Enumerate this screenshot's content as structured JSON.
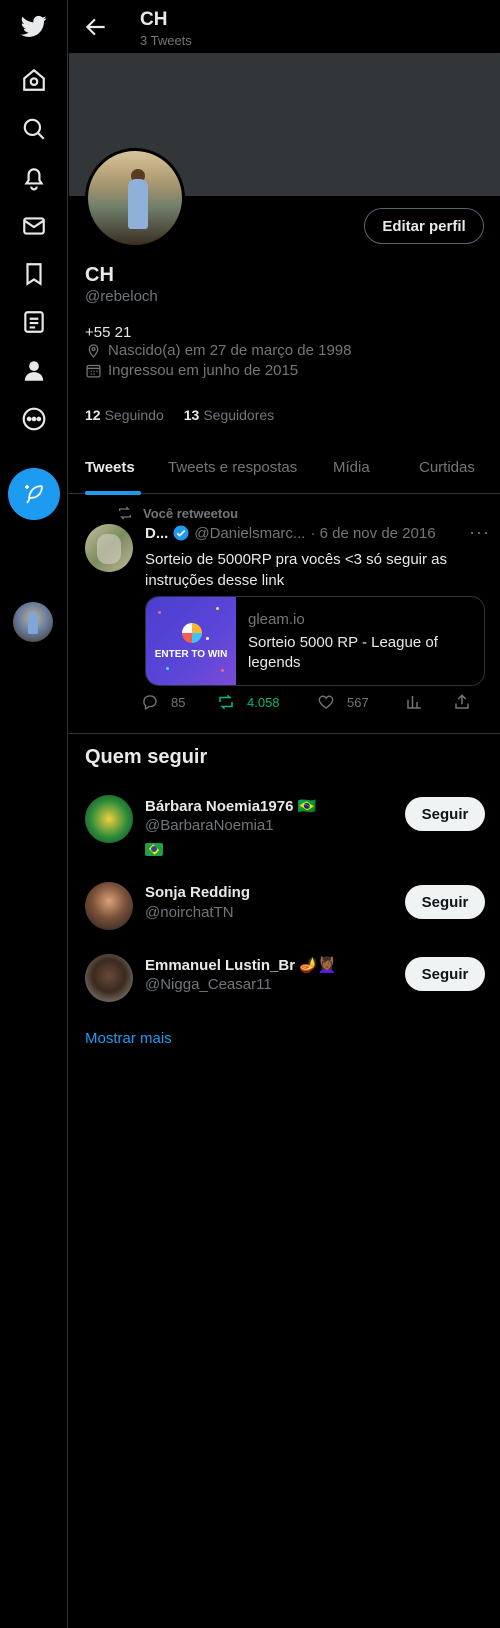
{
  "sidebar": {
    "items": [
      {
        "icon": "twitter-logo-icon"
      },
      {
        "icon": "home-icon"
      },
      {
        "icon": "search-icon"
      },
      {
        "icon": "bell-icon"
      },
      {
        "icon": "mail-icon"
      },
      {
        "icon": "bookmark-icon"
      },
      {
        "icon": "list-icon"
      },
      {
        "icon": "profile-icon"
      },
      {
        "icon": "more-icon"
      }
    ],
    "compose_icon": "compose-feather-icon"
  },
  "header": {
    "title": "CH",
    "subtitle": "3 Tweets"
  },
  "profile": {
    "edit_label": "Editar perfil",
    "name": "CH",
    "handle": "@rebeloch",
    "bio": "+55 21",
    "birth": "Nascido(a) em 27 de março de 1998",
    "joined": "Ingressou em junho de 2015",
    "following_count": "12",
    "following_label": "Seguindo",
    "followers_count": "13",
    "followers_label": "Seguidores"
  },
  "tabs": [
    {
      "label": "Tweets"
    },
    {
      "label": "Tweets e respostas"
    },
    {
      "label": "Mídia"
    },
    {
      "label": "Curtidas"
    }
  ],
  "tweet": {
    "retweet_label": "Você retweetou",
    "name": "D...",
    "handle": "@Danielsmarc...",
    "date": "· 6 de nov de 2016",
    "text": "Sorteio de 5000RP pra vocês <3 só seguir as instruções desse link",
    "card": {
      "image_text": "ENTER TO WIN",
      "domain": "gleam.io",
      "title": "Sorteio 5000 RP - League of legends"
    },
    "replies": "85",
    "retweets": "4.058",
    "likes": "567"
  },
  "who_to_follow": {
    "title": "Quem seguir",
    "follow_label": "Seguir",
    "users": [
      {
        "name": "Bárbara Noemia1976 🇧🇷",
        "handle": "@BarbaraNoemia1",
        "extra": "🇧🇷"
      },
      {
        "name": "Sonja Redding",
        "handle": "@noirchatTN"
      },
      {
        "name": "Emmanuel Lustin_Br 🪔💆🏾‍♀️",
        "handle": "@Nigga_Ceasar11"
      }
    ],
    "show_more": "Mostrar mais"
  },
  "colors": {
    "accent": "#1d9bf0",
    "retweet_green": "#00ba7c",
    "muted": "#71767b",
    "border": "#2f3336",
    "background": "#000000"
  }
}
